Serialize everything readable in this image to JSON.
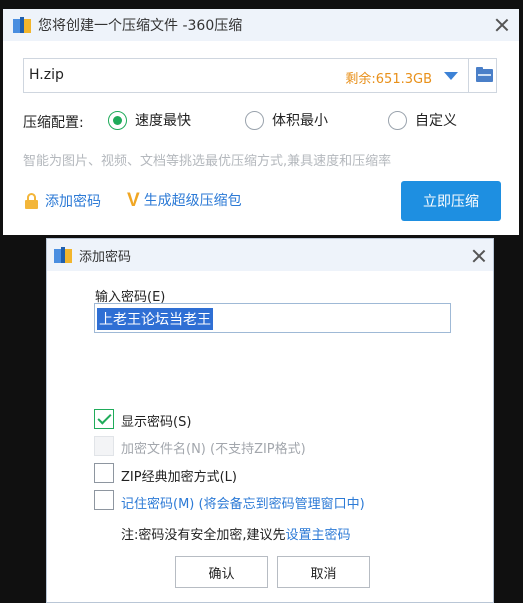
{
  "main": {
    "title": "您将创建一个压缩文件 -360压缩",
    "path_value": "H.zip",
    "free_space": "剩余:651.3GB",
    "config_label": "压缩配置:",
    "options": [
      {
        "label": "速度最快",
        "selected": true
      },
      {
        "label": "体积最小",
        "selected": false
      },
      {
        "label": "自定义",
        "selected": false
      }
    ],
    "hint": "智能为图片、视频、文档等挑选最优压缩方式,兼具速度和压缩率",
    "add_password": "添加密码",
    "super_package": "生成超级压缩包",
    "compress_button": "立即压缩",
    "icons": [
      "archive-icon",
      "close-icon",
      "dropdown-arrow-icon",
      "folder-icon",
      "lock-icon",
      "v-icon"
    ],
    "accent_color": "#1e8fe1",
    "free_color": "#e8901a"
  },
  "dialog": {
    "title": "添加密码",
    "input_label": "输入密码(E)",
    "password_value": "上老王论坛当老王",
    "checkboxes": [
      {
        "label": "显示密码(S)",
        "checked": true,
        "enabled": true
      },
      {
        "label": "加密文件名(N) (不支持ZIP格式)",
        "checked": false,
        "enabled": false
      },
      {
        "label": "ZIP经典加密方式(L)",
        "checked": false,
        "enabled": true
      },
      {
        "label": "记住密码(M) (将会备忘到密码管理窗口中)",
        "checked": false,
        "enabled": true
      }
    ],
    "note_prefix": "注:密码没有安全加密,建议先",
    "note_link": "设置主密码",
    "ok_button": "确认",
    "cancel_button": "取消"
  }
}
